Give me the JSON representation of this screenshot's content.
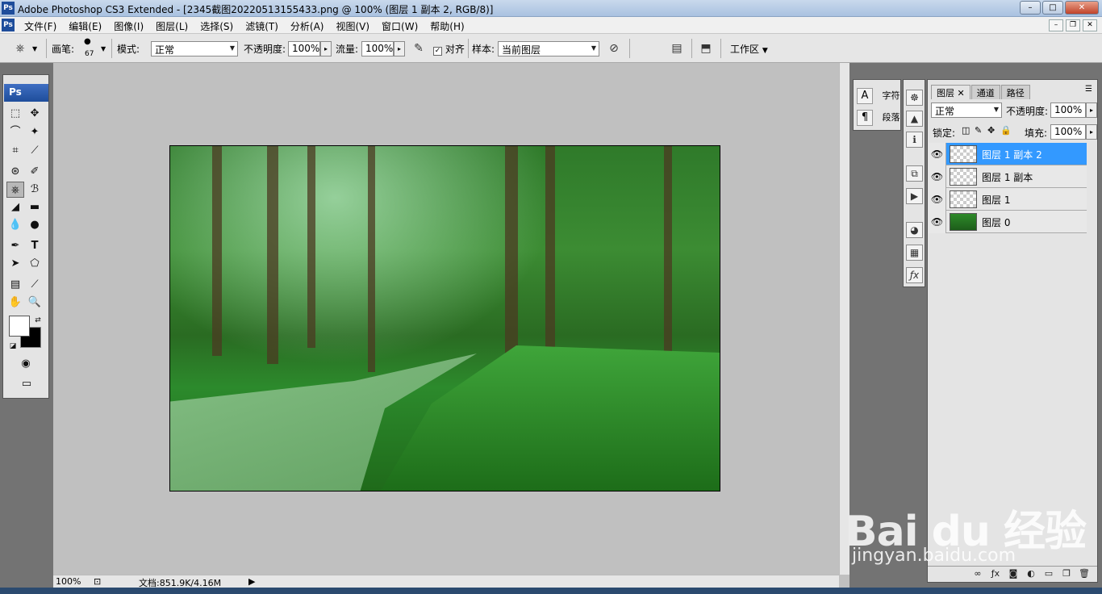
{
  "window": {
    "title": "Adobe Photoshop CS3 Extended - [2345截图20220513155433.png @ 100% (图层 1 副本 2, RGB/8)]",
    "logo": "Ps"
  },
  "menu": [
    "文件(F)",
    "编辑(E)",
    "图像(I)",
    "图层(L)",
    "选择(S)",
    "滤镜(T)",
    "分析(A)",
    "视图(V)",
    "窗口(W)",
    "帮助(H)"
  ],
  "options": {
    "brush_label": "画笔:",
    "brush_size": "67",
    "mode_label": "模式:",
    "mode_value": "正常",
    "opacity_label": "不透明度:",
    "opacity_value": "100%",
    "flow_label": "流量:",
    "flow_value": "100%",
    "align_label": "对齐",
    "sample_label": "样本:",
    "sample_value": "当前图层",
    "workspace_label": "工作区"
  },
  "toolbox": {
    "header": "Ps"
  },
  "status": {
    "zoom": "100%",
    "doc": "文档:851.9K/4.16M"
  },
  "char_panel": {
    "char_label": "字符",
    "para_label": "段落"
  },
  "layers_panel": {
    "tabs": [
      "图层",
      "通道",
      "路径"
    ],
    "blend_mode": "正常",
    "opacity_label": "不透明度:",
    "opacity_value": "100%",
    "lock_label": "锁定:",
    "fill_label": "填充:",
    "fill_value": "100%",
    "layers": [
      {
        "name": "图层 1 副本 2",
        "selected": true,
        "thumb": "transparent"
      },
      {
        "name": "图层 1 副本",
        "selected": false,
        "thumb": "transparent"
      },
      {
        "name": "图层 1",
        "selected": false,
        "thumb": "transparent"
      },
      {
        "name": "图层 0",
        "selected": false,
        "thumb": "photo"
      }
    ]
  },
  "watermark": {
    "main": "Bai du 经验",
    "sub": "jingyan.baidu.com"
  }
}
